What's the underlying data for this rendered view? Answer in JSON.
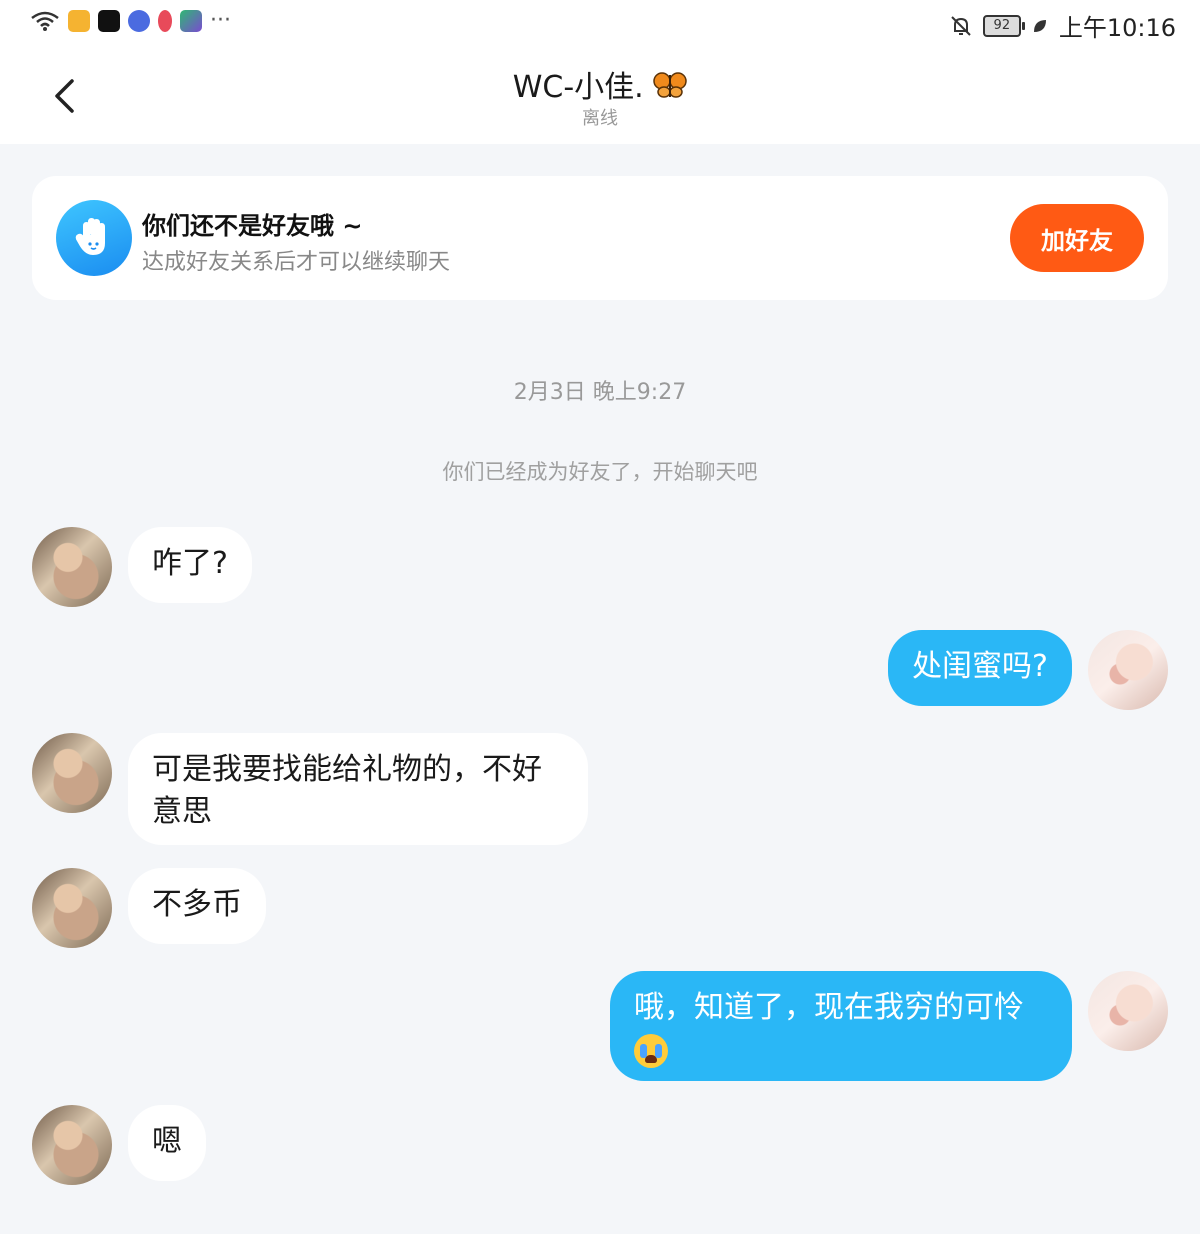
{
  "status_bar": {
    "time": "上午10:16",
    "battery": "92",
    "more": "···"
  },
  "header": {
    "title": "WC-小佳.",
    "title_icon": "butterfly-icon",
    "status": "离线"
  },
  "friend_card": {
    "title": "你们还不是好友哦 ~",
    "subtitle": "达成好友关系后才可以继续聊天",
    "button": "加好友",
    "icon": "hand-icon"
  },
  "colors": {
    "accent_orange": "#ff5a14",
    "bubble_blue": "#2ab7f6",
    "background": "#f4f6f9"
  },
  "chat": {
    "timestamp": "2月3日 晚上9:27",
    "system_message": "你们已经成为好友了，开始聊天吧",
    "messages": [
      {
        "side": "in",
        "text": "咋了?"
      },
      {
        "side": "out",
        "text": "处闺蜜吗?"
      },
      {
        "side": "in",
        "line1": "可是我要找能给礼物的，不好",
        "line2": "意思"
      },
      {
        "side": "in",
        "text": "不多币"
      },
      {
        "side": "out",
        "text": "哦，知道了，现在我穷的可怜",
        "emoji": "crying-face-emoji"
      },
      {
        "side": "in",
        "text": "嗯"
      }
    ]
  }
}
